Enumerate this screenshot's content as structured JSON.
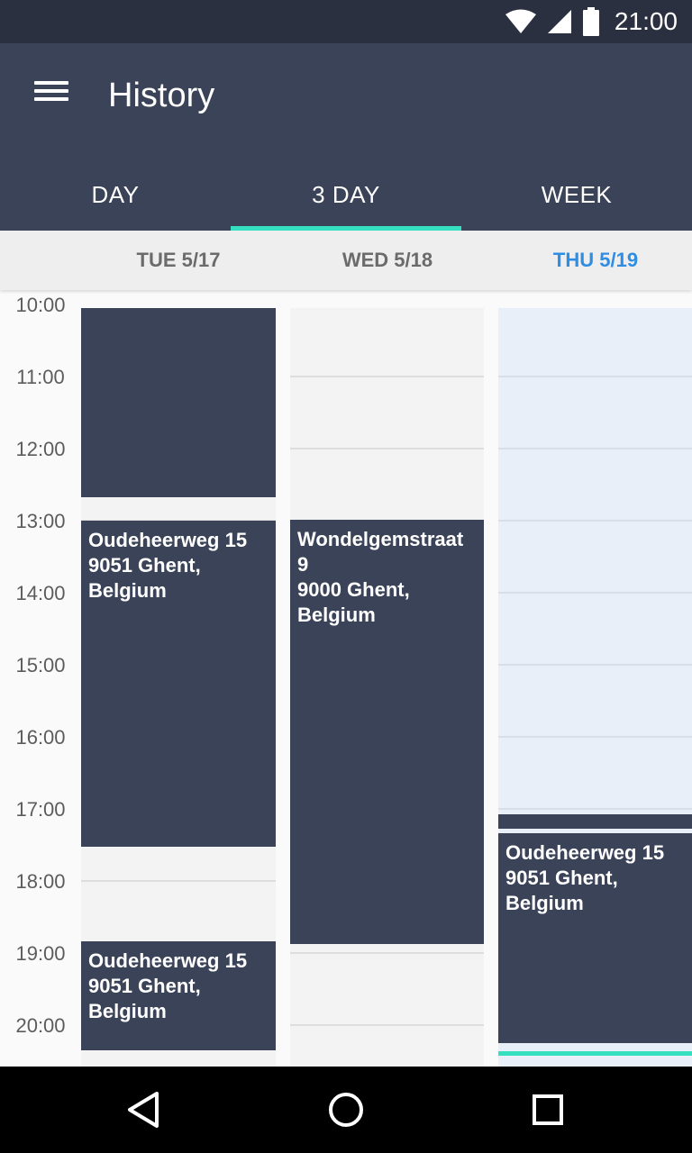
{
  "status": {
    "time": "21:00"
  },
  "appbar": {
    "title": "History"
  },
  "tabs": [
    {
      "label": "DAY",
      "active": false
    },
    {
      "label": "3 DAY",
      "active": true
    },
    {
      "label": "WEEK",
      "active": false
    }
  ],
  "days": [
    {
      "label": "TUE 5/17",
      "today": false
    },
    {
      "label": "WED 5/18",
      "today": false
    },
    {
      "label": "THU 5/19",
      "today": true
    }
  ],
  "hours": [
    "10:00",
    "11:00",
    "12:00",
    "13:00",
    "14:00",
    "15:00",
    "16:00",
    "17:00",
    "18:00",
    "19:00",
    "20:00"
  ],
  "events": {
    "tue": [
      {
        "text": ""
      },
      {
        "text": "Oudeheerweg 15\n9051 Ghent,\nBelgium"
      },
      {
        "text": "Oudeheerweg 15\n9051 Ghent,\nBelgium"
      }
    ],
    "wed": [
      {
        "text": "Wondelgemstraat\n9\n9000 Ghent,\nBelgium"
      }
    ],
    "thu": [
      {
        "text": ""
      },
      {
        "text": "Oudeheerweg 15\n9051 Ghent,\nBelgium"
      }
    ]
  },
  "colors": {
    "primary": "#3b4358",
    "accent": "#35e0c1",
    "today": "#2f8de4"
  }
}
